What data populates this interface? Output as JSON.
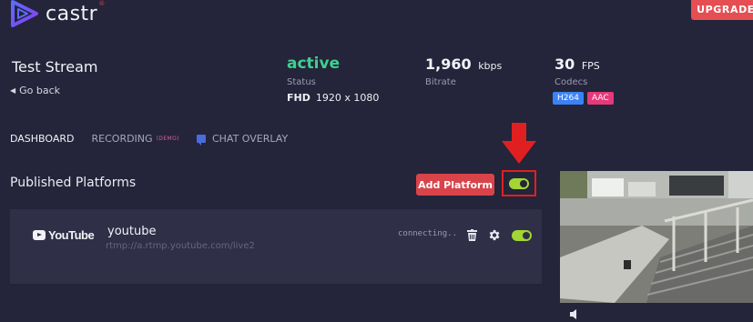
{
  "brand": {
    "name": "castr",
    "mark": "®"
  },
  "header": {
    "upgrade_label": "UPGRADE"
  },
  "stream": {
    "title": "Test Stream",
    "back_label": "Go back"
  },
  "stats": {
    "status_value": "active",
    "status_label": "Status",
    "resolution_label": "FHD",
    "resolution_value": "1920 x 1080",
    "bitrate_value": "1,960",
    "bitrate_unit": "kbps",
    "bitrate_label": "Bitrate",
    "fps_value": "30",
    "fps_unit": "FPS",
    "codecs_label": "Codecs",
    "codecs": [
      "H264",
      "AAC"
    ]
  },
  "tabs": {
    "dashboard": "DASHBOARD",
    "recording": "RECORDING",
    "recording_tag": "(DEMO)",
    "chat_overlay": "CHAT OVERLAY"
  },
  "platforms": {
    "title": "Published Platforms",
    "add_label": "Add Platform",
    "master_toggle_on": true,
    "items": [
      {
        "logo_text": "YouTube",
        "name": "youtube",
        "url": "rtmp://a.rtmp.youtube.com/live2",
        "status": "connecting..",
        "enabled": true
      }
    ]
  },
  "colors": {
    "background": "#24243a",
    "card": "#2f2f48",
    "active_green": "#3fcf8e",
    "toggle_green": "#a3d633",
    "accent_red": "#d9434a",
    "codec_h264": "#3b82f6",
    "codec_aac": "#e6397a",
    "highlight_red": "#e02020"
  },
  "icons": [
    "castr-logo-icon",
    "chevron-left-icon",
    "chat-icon",
    "red-arrow-down-icon",
    "youtube-play-icon",
    "trash-icon",
    "gear-icon",
    "speaker-icon"
  ]
}
